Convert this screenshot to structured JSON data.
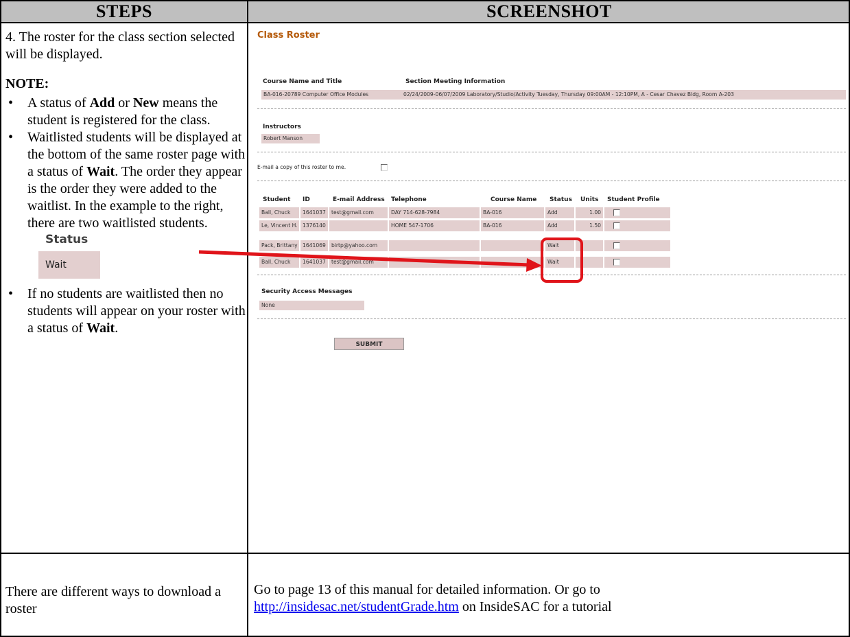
{
  "table_header": {
    "steps": "STEPS",
    "screenshot": "SCREENSHOT"
  },
  "steps": {
    "intro": "4.  The roster for the class section selected will be displayed.",
    "note_title": "NOTE:",
    "bullet1": {
      "pre": "A status of ",
      "b1": "Add",
      "mid": " or ",
      "b2": "New",
      "post": " means the student is registered for the class."
    },
    "bullet2": {
      "pre": "Waitlisted students will be displayed at the bottom of the same roster page with a status of ",
      "b": "Wait",
      "post": ".  The order they appear is the order they were added to the waitlist.  In the example to the right, there are two waitlisted students."
    },
    "status_sample": {
      "label": "Status",
      "value": "Wait"
    },
    "bullet3": {
      "pre": "If no students are waitlisted then no students will appear on your roster with a status of ",
      "b": "Wait",
      "post": "."
    }
  },
  "roster": {
    "title": "Class Roster",
    "course_label": "Course Name and Title",
    "course_value": "BA-016-20789 Computer Office Modules",
    "section_label": "Section Meeting Information",
    "section_value": "02/24/2009-06/07/2009 Laboratory/Studio/Activity Tuesday, Thursday 09:00AM - 12:10PM, A - Cesar Chavez Bldg, Room A-203",
    "instructors_label": "Instructors",
    "instructor": "Robert Manson",
    "email_copy": "E-mail a copy of this roster to me.",
    "columns": [
      "Student",
      "ID",
      "E-mail Address",
      "Telephone",
      "Course Name",
      "Status",
      "Units",
      "Student Profile"
    ],
    "rows": [
      {
        "student": "Ball, Chuck",
        "id": "1641037",
        "email": "test@gmail.com",
        "phone": "DAY 714-628-7984",
        "course": "BA-016",
        "status": "Add",
        "units": "1.00"
      },
      {
        "student": "Le, Vincent H.",
        "id": "1376140",
        "email": "",
        "phone": "HOME 547-1706",
        "course": "BA-016",
        "status": "Add",
        "units": "1.50"
      },
      {
        "student": "Pack, Brittany",
        "id": "1641069",
        "email": "birtp@yahoo.com",
        "phone": "",
        "course": "",
        "status": "Wait",
        "units": ""
      },
      {
        "student": "Ball, Chuck",
        "id": "1641037",
        "email": "test@gmail.com",
        "phone": "",
        "course": "",
        "status": "Wait",
        "units": ""
      }
    ],
    "security_label": "Security Access Messages",
    "security_value": "None",
    "submit": "SUBMIT"
  },
  "bottom": {
    "left": "There are different ways to download a roster",
    "right_pre": "Go to page 13 of this manual  for detailed information.  Or go to",
    "link": "http://insidesac.net/studentGrade.htm",
    "right_post": "  on InsideSAC for a tutorial"
  },
  "colors": {
    "cell_bg": "#e3cfcf",
    "title_orange": "#b55a0a",
    "arrow_red": "#e0141a",
    "header_gray": "#bfbfbf"
  }
}
